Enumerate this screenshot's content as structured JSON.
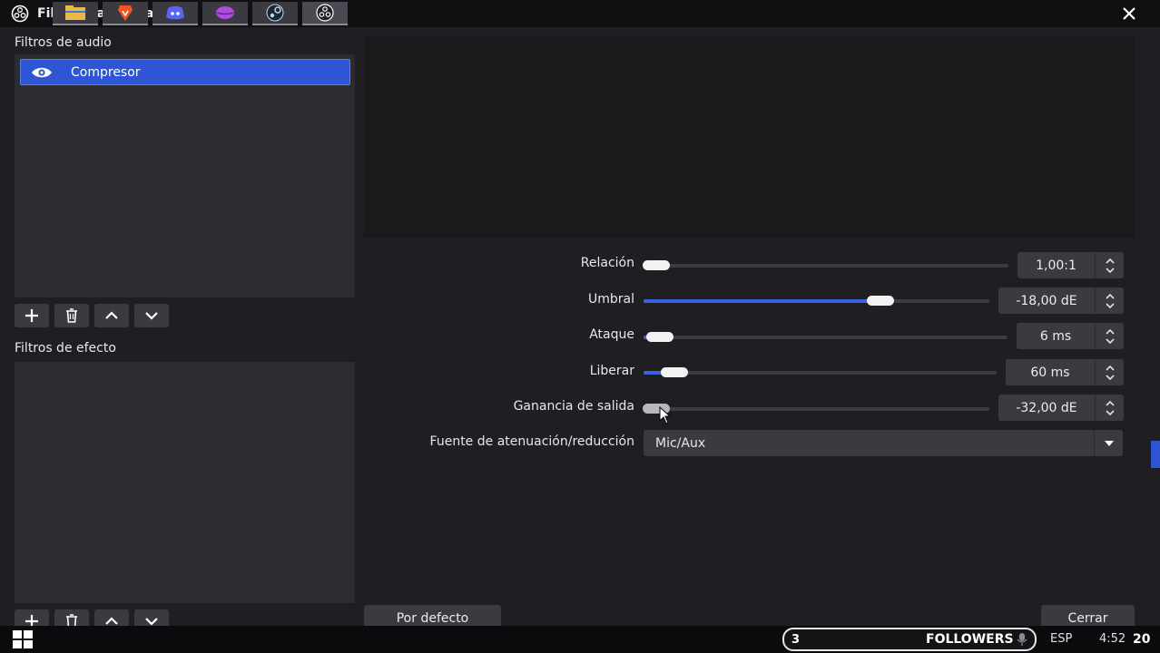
{
  "window": {
    "title": "Filtros para 'chat'"
  },
  "audio_filters": {
    "label": "Filtros de audio",
    "items": [
      {
        "name": "Compresor",
        "selected": true
      }
    ]
  },
  "effect_filters": {
    "label": "Filtros de efecto",
    "items": []
  },
  "properties": [
    {
      "label": "Relación",
      "value": "1,00:1",
      "fraction": 0.0
    },
    {
      "label": "Umbral",
      "value": "-18,00 dE",
      "fraction": 0.7
    },
    {
      "label": "Ataque",
      "value": "6 ms",
      "fraction": 0.01
    },
    {
      "label": "Liberar",
      "value": "60 ms",
      "fraction": 0.05
    },
    {
      "label": "Ganancia de salida",
      "value": "-32,00 dE",
      "fraction": 0.0
    }
  ],
  "duck": {
    "label": "Fuente de atenuación/reducción",
    "value": "Mic/Aux"
  },
  "buttons": {
    "defaults": "Por defecto",
    "close": "Cerrar"
  },
  "taskbar": {
    "followers_count": "3",
    "followers_label": "FOLLOWERS",
    "lang": "ESP",
    "clock": "4:52",
    "corner_num": "20"
  },
  "colors": {
    "accent": "#2d55d4",
    "bg": "#1f1f23",
    "panel": "#2b2b30",
    "control": "#3a3a40"
  }
}
